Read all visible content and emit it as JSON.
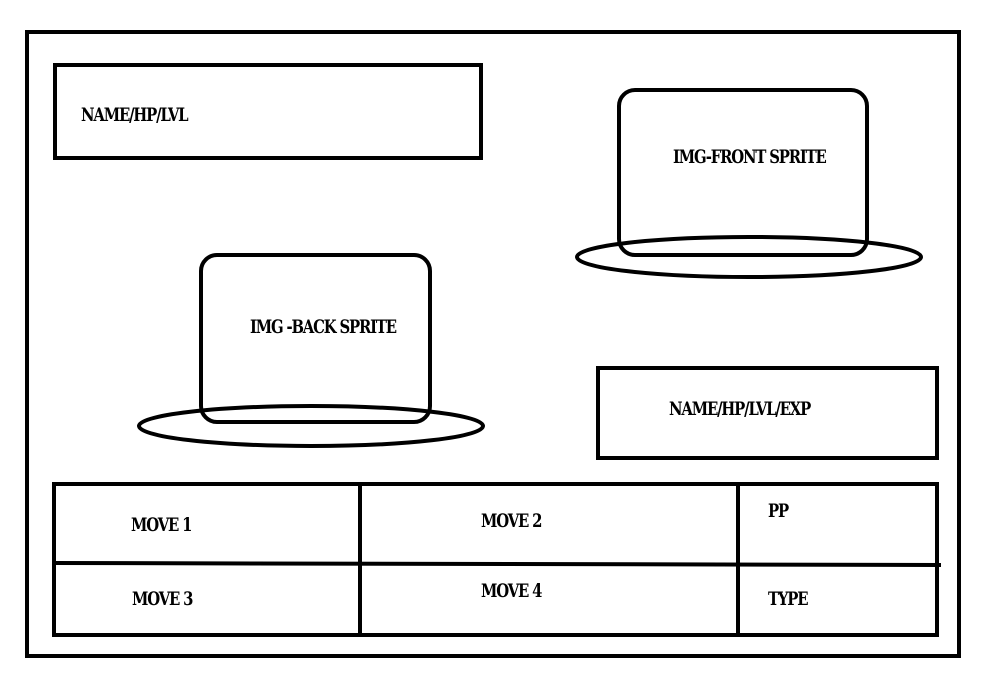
{
  "enemy_info": {
    "label": "NAME/HP/LVL"
  },
  "enemy_sprite": {
    "label": "IMG-FRONT SPRITE"
  },
  "player_sprite": {
    "label": "IMG -BACK SPRITE"
  },
  "player_info": {
    "label": "NAME/HP/LVL/EXP"
  },
  "moves": [
    {
      "label": "MOVE 1"
    },
    {
      "label": "MOVE 2"
    },
    {
      "label": "MOVE 3"
    },
    {
      "label": "MOVE 4"
    }
  ],
  "pp": {
    "label": "PP"
  },
  "type": {
    "label": "TYPE"
  }
}
